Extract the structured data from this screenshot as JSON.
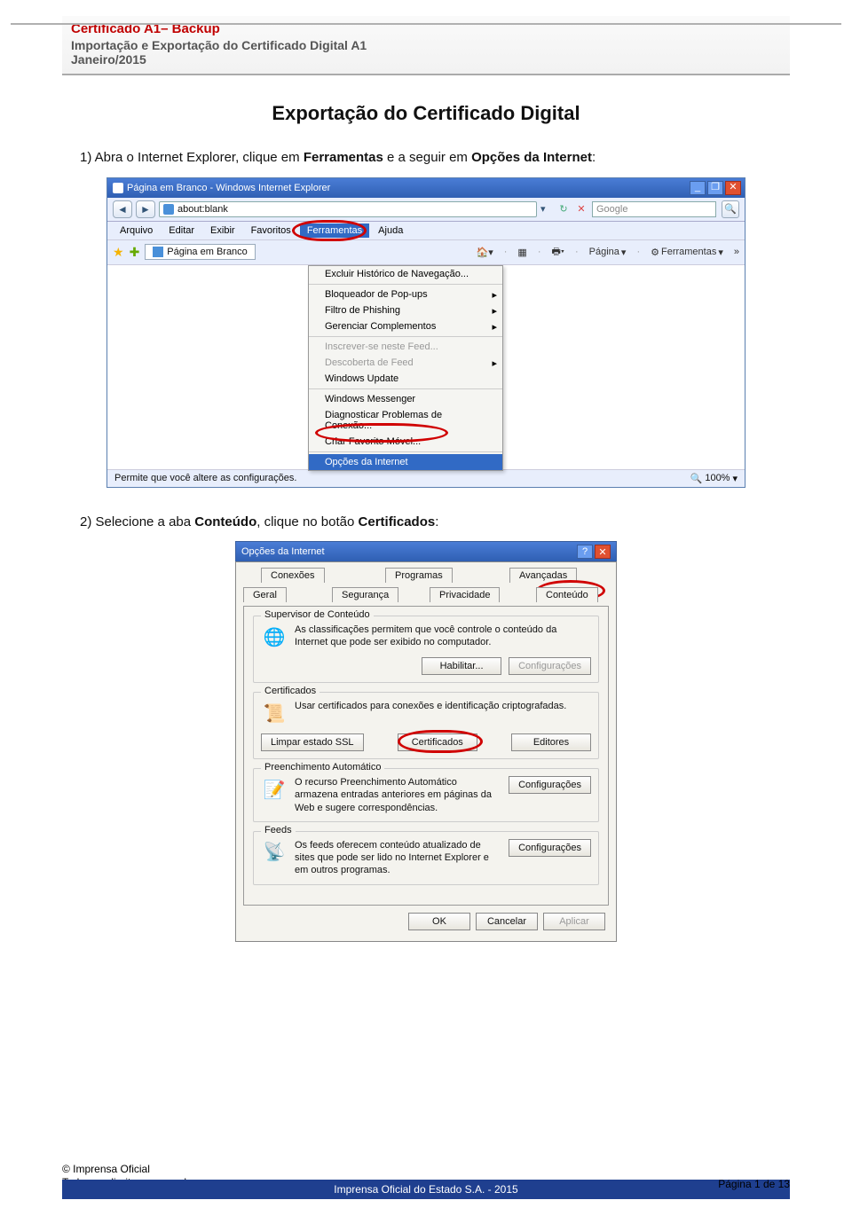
{
  "header": {
    "title": "Certificado A1– Backup",
    "subtitle": "Importação e Exportação do Certificado Digital A1",
    "date": "Janeiro/2015"
  },
  "main_title": "Exportação do Certificado Digital",
  "step1": {
    "prefix": "1) Abra o Internet Explorer, clique em ",
    "bold1": "Ferramentas",
    "mid": " e a seguir em ",
    "bold2": "Opções da Internet",
    "suffix": ":"
  },
  "ie": {
    "title": "Página em Branco - Windows Internet Explorer",
    "address_url": "about:blank",
    "search_placeholder": "Google",
    "menubar": [
      "Arquivo",
      "Editar",
      "Exibir",
      "Favoritos",
      "Ferramentas",
      "Ajuda"
    ],
    "active_menu_index": 4,
    "tab_label": "Página em Branco",
    "toolbar": {
      "pagina": "Página",
      "ferramentas": "Ferramentas"
    },
    "menu_items": [
      {
        "label": "Excluir Histórico de Navegação...",
        "sub": false
      },
      {
        "sep": true
      },
      {
        "label": "Bloqueador de Pop-ups",
        "sub": true
      },
      {
        "label": "Filtro de Phishing",
        "sub": true
      },
      {
        "label": "Gerenciar Complementos",
        "sub": true
      },
      {
        "sep": true
      },
      {
        "label": "Inscrever-se neste Feed...",
        "sub": false,
        "disabled": true
      },
      {
        "label": "Descoberta de Feed",
        "sub": true,
        "disabled": true
      },
      {
        "label": "Windows Update",
        "sub": false
      },
      {
        "sep": true
      },
      {
        "label": "Windows Messenger",
        "sub": false
      },
      {
        "label": "Diagnosticar Problemas de Conexão...",
        "sub": false
      },
      {
        "label": "Criar Favorito Móvel...",
        "sub": false
      },
      {
        "sep": true
      },
      {
        "label": "Opções da Internet",
        "sub": false,
        "highlight": true
      }
    ],
    "status_text": "Permite que você altere as configurações.",
    "zoom": "100%"
  },
  "step2": {
    "prefix": "2) Selecione a aba ",
    "bold1": "Conteúdo",
    "mid": ", clique no botão ",
    "bold2": "Certificados",
    "suffix": ":"
  },
  "dialog": {
    "title": "Opções da Internet",
    "tabs_row1": [
      "Conexões",
      "Programas",
      "Avançadas"
    ],
    "tabs_row2": [
      "Geral",
      "Segurança",
      "Privacidade",
      "Conteúdo"
    ],
    "active_tab": "Conteúdo",
    "supervisor": {
      "legend": "Supervisor de Conteúdo",
      "text": "As classificações permitem que você controle o conteúdo da Internet que pode ser exibido no computador.",
      "btn_enable": "Habilitar...",
      "btn_config": "Configurações"
    },
    "certs": {
      "legend": "Certificados",
      "text": "Usar certificados para conexões e identificação criptografadas.",
      "btn_ssl": "Limpar estado SSL",
      "btn_cert": "Certificados",
      "btn_editors": "Editores"
    },
    "autofill": {
      "legend": "Preenchimento Automático",
      "text": "O recurso Preenchimento Automático armazena entradas anteriores em páginas da Web e sugere correspondências.",
      "btn_config": "Configurações"
    },
    "feeds": {
      "legend": "Feeds",
      "text": "Os feeds oferecem conteúdo atualizado de sites que pode ser lido no Internet Explorer e em outros programas.",
      "btn_config": "Configurações"
    },
    "foot": {
      "ok": "OK",
      "cancel": "Cancelar",
      "apply": "Aplicar"
    }
  },
  "footer": {
    "copyright": "© Imprensa Oficial",
    "rights": "Todos os direitos reservados.",
    "center": "Imprensa Oficial do Estado S.A. - 2015",
    "page": "Página 1 de 13"
  }
}
